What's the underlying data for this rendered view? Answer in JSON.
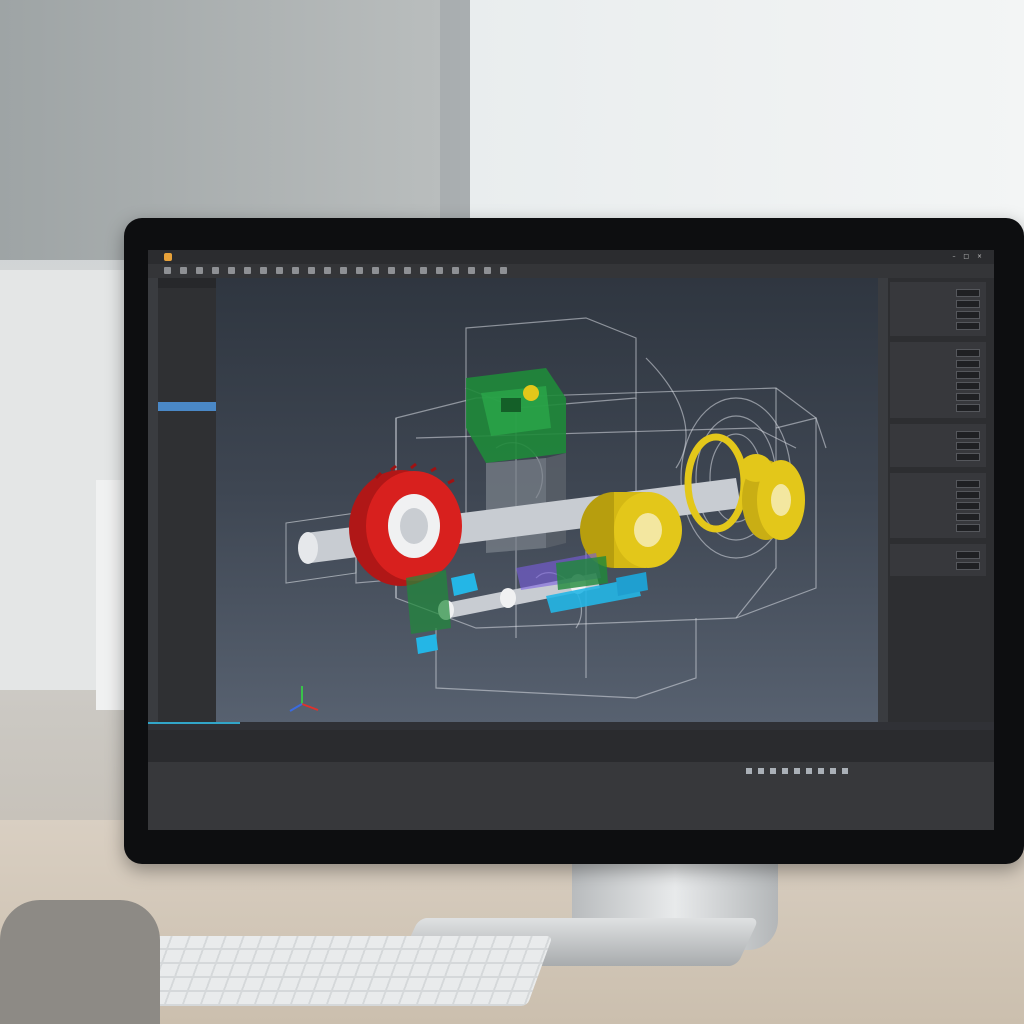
{
  "app": {
    "title": ""
  },
  "menu": {
    "items": [
      "",
      "",
      "",
      "",
      "",
      ""
    ]
  },
  "window_controls": [
    "–",
    "□",
    "×"
  ],
  "tree": {
    "header": "",
    "items": [
      "",
      "",
      "",
      "",
      "",
      "",
      "",
      "",
      "",
      "",
      "",
      "",
      "",
      "",
      ""
    ],
    "selected_index": 10
  },
  "properties": {
    "sections": [
      {
        "rows": [
          "",
          "",
          "",
          ""
        ]
      },
      {
        "rows": [
          "",
          "",
          "",
          "",
          "",
          ""
        ]
      },
      {
        "rows": [
          "",
          "",
          ""
        ]
      },
      {
        "rows": [
          "",
          "",
          "",
          "",
          ""
        ]
      },
      {
        "rows": [
          "",
          ""
        ]
      }
    ]
  },
  "model": {
    "part_colors": {
      "housing_wire": "#d9dde3",
      "gear_red": "#d8201e",
      "bearing_yellow": "#e3c71a",
      "pcb_green": "#1f8a3a",
      "fitting_cyan": "#24b6e6",
      "shaft_grey": "#c8ccd2",
      "accent_purple": "#7a5de0"
    }
  },
  "icons": {
    "app": "app-logo-icon",
    "view_cube": "view-cube-icon",
    "axis": "axis-triad-icon"
  }
}
